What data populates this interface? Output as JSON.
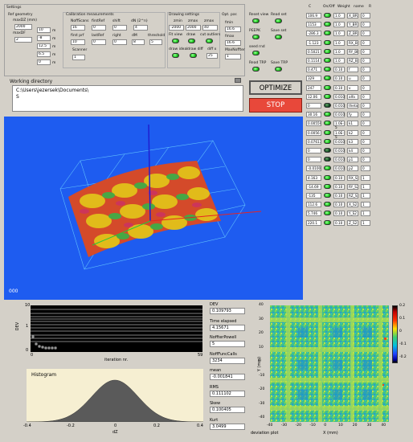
{
  "settings": {
    "title": "Settings",
    "ref_geometry": {
      "label": "Ref geometry",
      "maxdz_label": "maxDZ (mm)",
      "maxdz_value": "2000",
      "maxdf_label": "maxDF",
      "maxdf_value": "2"
    },
    "small_fields": [
      "10",
      "-8",
      "12.5",
      "6.5",
      "0"
    ],
    "small_units": [
      "m",
      "m",
      "m",
      "m",
      "m"
    ],
    "calibration": {
      "title": "Calibration measurements",
      "labels": [
        "NoffScans",
        "firstRef",
        "shift",
        "dN (2^n)"
      ],
      "values": [
        "16",
        "0",
        "0",
        "4"
      ],
      "labels2": [
        "first prf",
        "lastRef",
        "right",
        "dM",
        "threshold"
      ],
      "values2": [
        "10",
        "0",
        "0",
        "8",
        "5"
      ],
      "scanner_label": "Scanner",
      "scanner_value": "1"
    },
    "drawing": {
      "title": "Drawing settings",
      "labels": [
        "zmin",
        "zmax",
        "zmax"
      ],
      "values": [
        "-2000",
        "2000",
        "40"
      ],
      "labels2": [
        "Fit view",
        "draw",
        "cut outliers"
      ],
      "labels3": [
        "draw ideal",
        "draw diff",
        "diff x"
      ],
      "diff_value": "25"
    },
    "opt_par": {
      "title": "Opt. par.",
      "labels": [
        "fmin",
        "fmax",
        "MaxNoffter"
      ],
      "values": [
        "16.6",
        "16.6",
        "1"
      ]
    },
    "buttons": [
      {
        "label": "Reset view"
      },
      {
        "label": "Read set"
      },
      {
        "label": "PEEPK"
      },
      {
        "label": "Save set"
      },
      {
        "label": "seed rnd"
      },
      {
        "label": "Read TRP"
      },
      {
        "label": "Save TRP"
      }
    ]
  },
  "working_directory": {
    "label": "Working directory",
    "value": "C:\\Users\\jezersek\\Documents\\",
    "line2": "S"
  },
  "optimize_label": "OPTIMIZE",
  "stop_label": "STOP",
  "viewer": {
    "corner_label": "000"
  },
  "table": {
    "headers": [
      "C",
      "On/Off",
      "Weight",
      "name",
      "R"
    ],
    "rows": [
      {
        "value": "106.9",
        "on": true,
        "weight": "1.0",
        "name": "X_BR",
        "r": "0"
      },
      {
        "value": "1153",
        "on": true,
        "weight": "1.0",
        "name": "Y_BR",
        "r": "0"
      },
      {
        "value": "-286.3",
        "on": true,
        "weight": "1.0",
        "name": "Z_BR",
        "r": "0"
      },
      {
        "value": "-1.123",
        "on": true,
        "weight": "1.0",
        "name": "RX_BR",
        "r": "0"
      },
      {
        "value": "0.5021",
        "on": true,
        "weight": "1.0",
        "name": "RY_BR",
        "r": "0"
      },
      {
        "value": "0.1114",
        "on": true,
        "weight": "1.0",
        "name": "RZ_BR",
        "r": "0"
      },
      {
        "value": "0.471",
        "on": true,
        "weight": "0.10",
        "name": "f",
        "r": "0"
      },
      {
        "value": "329",
        "on": true,
        "weight": "0.10",
        "name": "u",
        "r": "0"
      },
      {
        "value": "247",
        "on": true,
        "weight": "0.10",
        "name": "v",
        "r": "0"
      },
      {
        "value": "12.06",
        "on": true,
        "weight": "0.010",
        "name": "alfa",
        "r": "0"
      },
      {
        "value": "0",
        "on": false,
        "weight": "0.010",
        "name": "theta",
        "r": "0"
      },
      {
        "value": "30.16",
        "on": true,
        "weight": "0.010",
        "name": "fy",
        "r": "0"
      },
      {
        "value": "0.00559",
        "on": true,
        "weight": "1.0E-5",
        "name": "k1",
        "r": "0"
      },
      {
        "value": "0.0056",
        "on": true,
        "weight": "1.0E-5",
        "name": "k2",
        "r": "0"
      },
      {
        "value": "0.07613",
        "on": true,
        "weight": "0.010",
        "name": "k3",
        "r": "0"
      },
      {
        "value": "0",
        "on": false,
        "weight": "0.010",
        "name": "k4",
        "r": "0"
      },
      {
        "value": "0",
        "on": false,
        "weight": "0.010",
        "name": "p1",
        "r": "0"
      },
      {
        "value": "-0.01009",
        "on": true,
        "weight": "0.010",
        "name": "p2",
        "r": "0"
      },
      {
        "value": "4.163",
        "on": true,
        "weight": "0.10",
        "name": "RX_S2",
        "r": "1"
      },
      {
        "value": "-14.69",
        "on": true,
        "weight": "0.10",
        "name": "RY_S2",
        "r": "1"
      },
      {
        "value": "-135",
        "on": true,
        "weight": "0.10",
        "name": "RZ_S2",
        "r": "1"
      },
      {
        "value": "112.6",
        "on": true,
        "weight": "0.10",
        "name": "X_S2",
        "r": "1"
      },
      {
        "value": "5.746",
        "on": true,
        "weight": "0.10",
        "name": "Y_S2",
        "r": "1"
      },
      {
        "value": "220.1",
        "on": true,
        "weight": "0.10",
        "name": "Z_S2",
        "r": "1"
      }
    ]
  },
  "dev_plot": {
    "ylabel": "DEV",
    "xlabel": "iteration nr.",
    "y_ticks": [
      "10",
      "1",
      "0"
    ],
    "x_ticks": [
      "0",
      "59"
    ]
  },
  "stats": [
    {
      "label": "DEV",
      "value": "0.109793"
    },
    {
      "label": "Time elapsed",
      "value": "4.15671"
    },
    {
      "label": "NoffterPowell",
      "value": "5"
    },
    {
      "label": "NoffFuncCalls",
      "value": "3234"
    },
    {
      "label": "mean",
      "value": "-0.001841"
    },
    {
      "label": "RMS",
      "value": "0.111102"
    },
    {
      "label": "Skew",
      "value": "0.100405"
    },
    {
      "label": "Kurt",
      "value": "3.0499"
    }
  ],
  "histogram": {
    "title": "Histogram",
    "xlabel": "dZ",
    "x_ticks": [
      "-0.4",
      "-0.2",
      "0",
      "0.2",
      "0.4"
    ]
  },
  "deviation_plot": {
    "caption": "deviation plot",
    "xlabel": "X (mm)",
    "ylabel": "Y (mm)",
    "x_ticks": [
      "-40",
      "-30",
      "-20",
      "-10",
      "0",
      "10",
      "20",
      "30",
      "40"
    ],
    "y_ticks": [
      "40",
      "30",
      "20",
      "10",
      "0",
      "-10",
      "-20",
      "-30",
      "-40"
    ],
    "colorbar_ticks": [
      "0.2",
      "0.1",
      "0",
      "-0.1",
      "-0.2"
    ]
  },
  "colors": {
    "viewer_bg": "#1e5cf0",
    "optimize_bg": "#d4d0c8",
    "stop_bg": "#e8483a",
    "hist_bg": "#f6efd2"
  }
}
